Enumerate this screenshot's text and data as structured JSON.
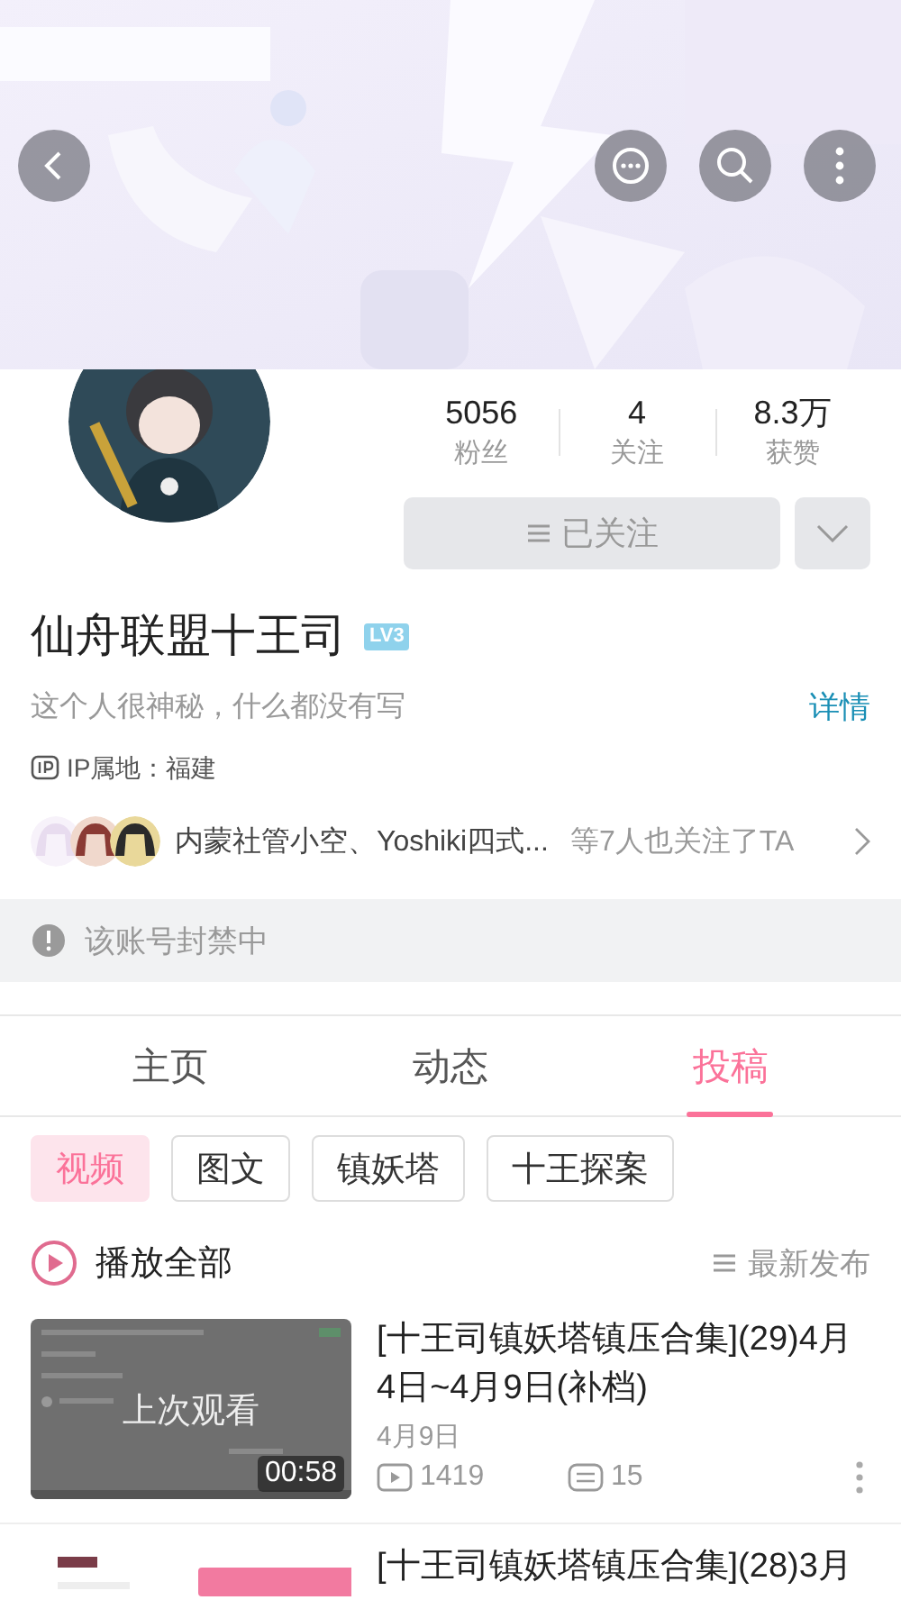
{
  "stats": [
    {
      "value": "5056",
      "label": "粉丝"
    },
    {
      "value": "4",
      "label": "关注"
    },
    {
      "value": "8.3万",
      "label": "获赞"
    }
  ],
  "follow_button": {
    "label": "已关注",
    "followed": true
  },
  "name": "仙舟联盟十王司",
  "level_badge": "LV3",
  "bio": "这个人很神秘，什么都没有写",
  "details_link": "详情",
  "ip_location": "IP属地：福建",
  "mutual_followers": {
    "names": "内蒙社管小空、Yoshiki四式...",
    "count_text": "等7人也关注了TA"
  },
  "notice": "该账号封禁中",
  "tabs": [
    {
      "label": "主页",
      "selected": false
    },
    {
      "label": "动态",
      "selected": false
    },
    {
      "label": "投稿",
      "selected": true
    }
  ],
  "chips": [
    {
      "label": "视频",
      "selected": true
    },
    {
      "label": "图文",
      "selected": false
    },
    {
      "label": "镇妖塔",
      "selected": false
    },
    {
      "label": "十王探案",
      "selected": false
    }
  ],
  "play_all": "播放全部",
  "sort": "最新发布",
  "videos": [
    {
      "title": "[十王司镇妖塔镇压合集](29)4月4日~4月9日(补档)",
      "overlay": "上次观看",
      "duration": "00:58",
      "date": "4月9日",
      "views": "1419",
      "comments": "15"
    },
    {
      "title": "[十王司镇妖塔镇压合集](28)3月"
    }
  ]
}
